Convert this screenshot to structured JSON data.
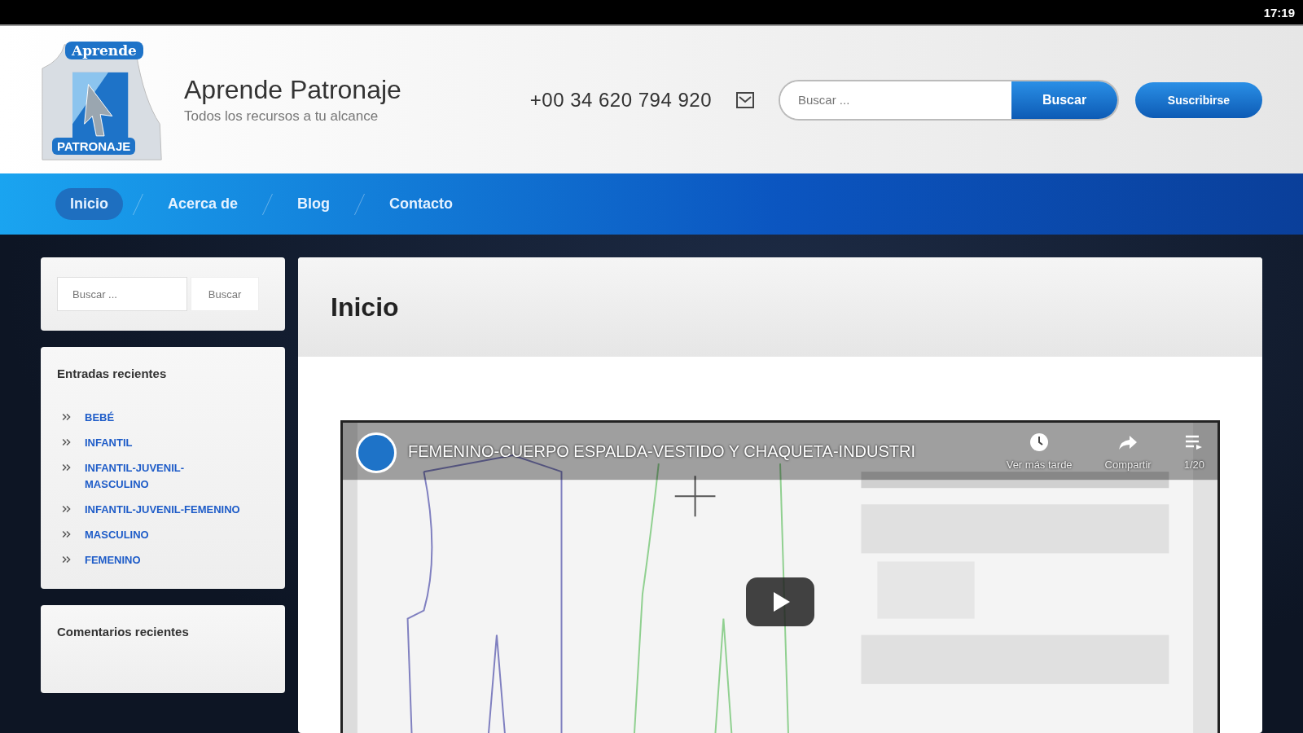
{
  "status_bar": {
    "time": "17:19"
  },
  "header": {
    "logo_top": "Aprende",
    "logo_bottom": "PATRONAJE",
    "site_title": "Aprende Patronaje",
    "tagline": "Todos los recursos a tu alcance",
    "phone": "+00 34 620 794 920",
    "search": {
      "placeholder": "Buscar ...",
      "button": "Buscar"
    },
    "subscribe": "Suscribirse"
  },
  "nav": [
    {
      "label": "Inicio",
      "selected": true
    },
    {
      "label": "Acerca de",
      "selected": false
    },
    {
      "label": "Blog",
      "selected": false
    },
    {
      "label": "Contacto",
      "selected": false
    }
  ],
  "sidebar": {
    "search": {
      "placeholder": "Buscar ...",
      "button": "Buscar"
    },
    "recent_posts": {
      "title": "Entradas recientes",
      "items": [
        "BEBÉ",
        "INFANTIL",
        "INFANTIL-JUVENIL-MASCULINO",
        "INFANTIL-JUVENIL-FEMENINO",
        "MASCULINO",
        "FEMENINO"
      ]
    },
    "recent_comments": {
      "title": "Comentarios recientes"
    }
  },
  "main": {
    "title": "Inicio",
    "video": {
      "kind": "picture",
      "title": "FEMENINO-CUERPO ESPALDA-VESTIDO Y CHAQUETA-INDUSTRI",
      "actions": [
        "Ver más tarde",
        "Compartir",
        "1/20"
      ]
    }
  }
}
